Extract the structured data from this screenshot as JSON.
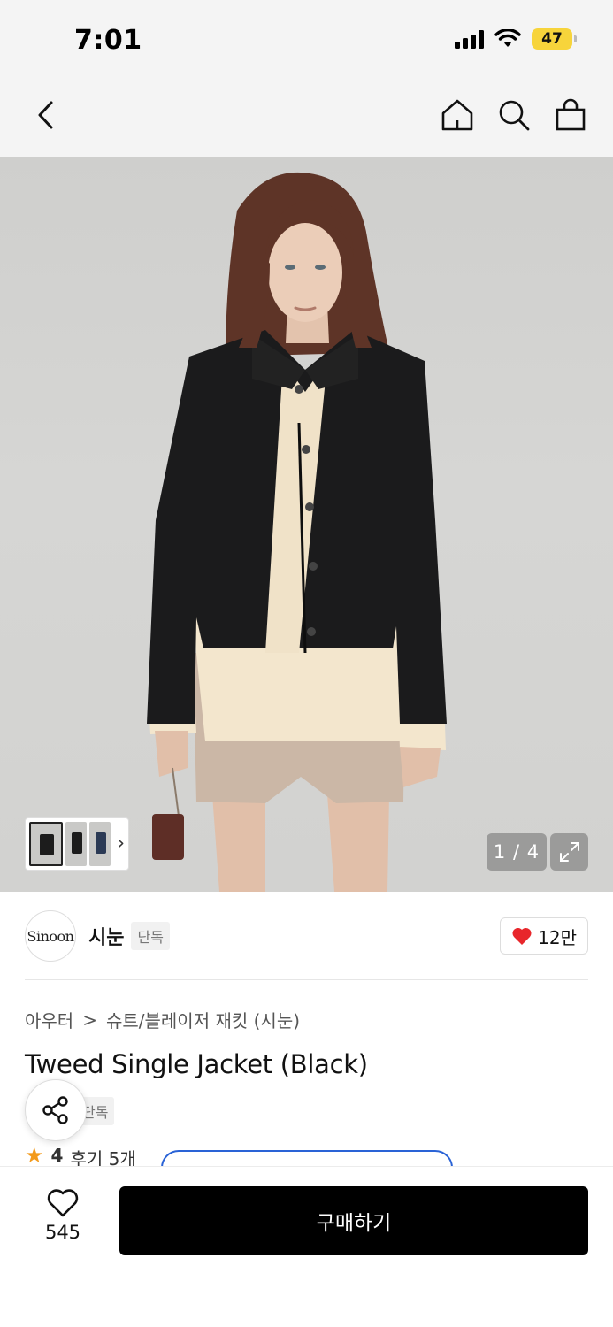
{
  "status_bar": {
    "time": "7:01",
    "battery": "47"
  },
  "nav": {
    "back_icon": "chevron-left-icon",
    "icons": [
      "home-icon",
      "search-icon",
      "shopping-bag-icon"
    ]
  },
  "gallery": {
    "counter": "1 / 4",
    "current_page": 1,
    "total_pages": 4
  },
  "brand": {
    "logo_text": "Sinoon",
    "name": "시눈",
    "tag": "단독",
    "likes": "12만"
  },
  "product": {
    "breadcrumb": [
      "아우터",
      "슈트/블레이저 재킷 (시눈)"
    ],
    "breadcrumb_separator": ">",
    "title": "Tweed Single Jacket (Black)",
    "tag": "단독",
    "rating": "4",
    "reviews": "후기 5개"
  },
  "bottom_bar": {
    "wishlist_count": "545",
    "buy_label": "구매하기"
  },
  "colors": {
    "accent_red": "#e8262b",
    "rating_star": "#f39a1b",
    "coupon_blue": "#2a63d6",
    "buy_button": "#000000"
  }
}
